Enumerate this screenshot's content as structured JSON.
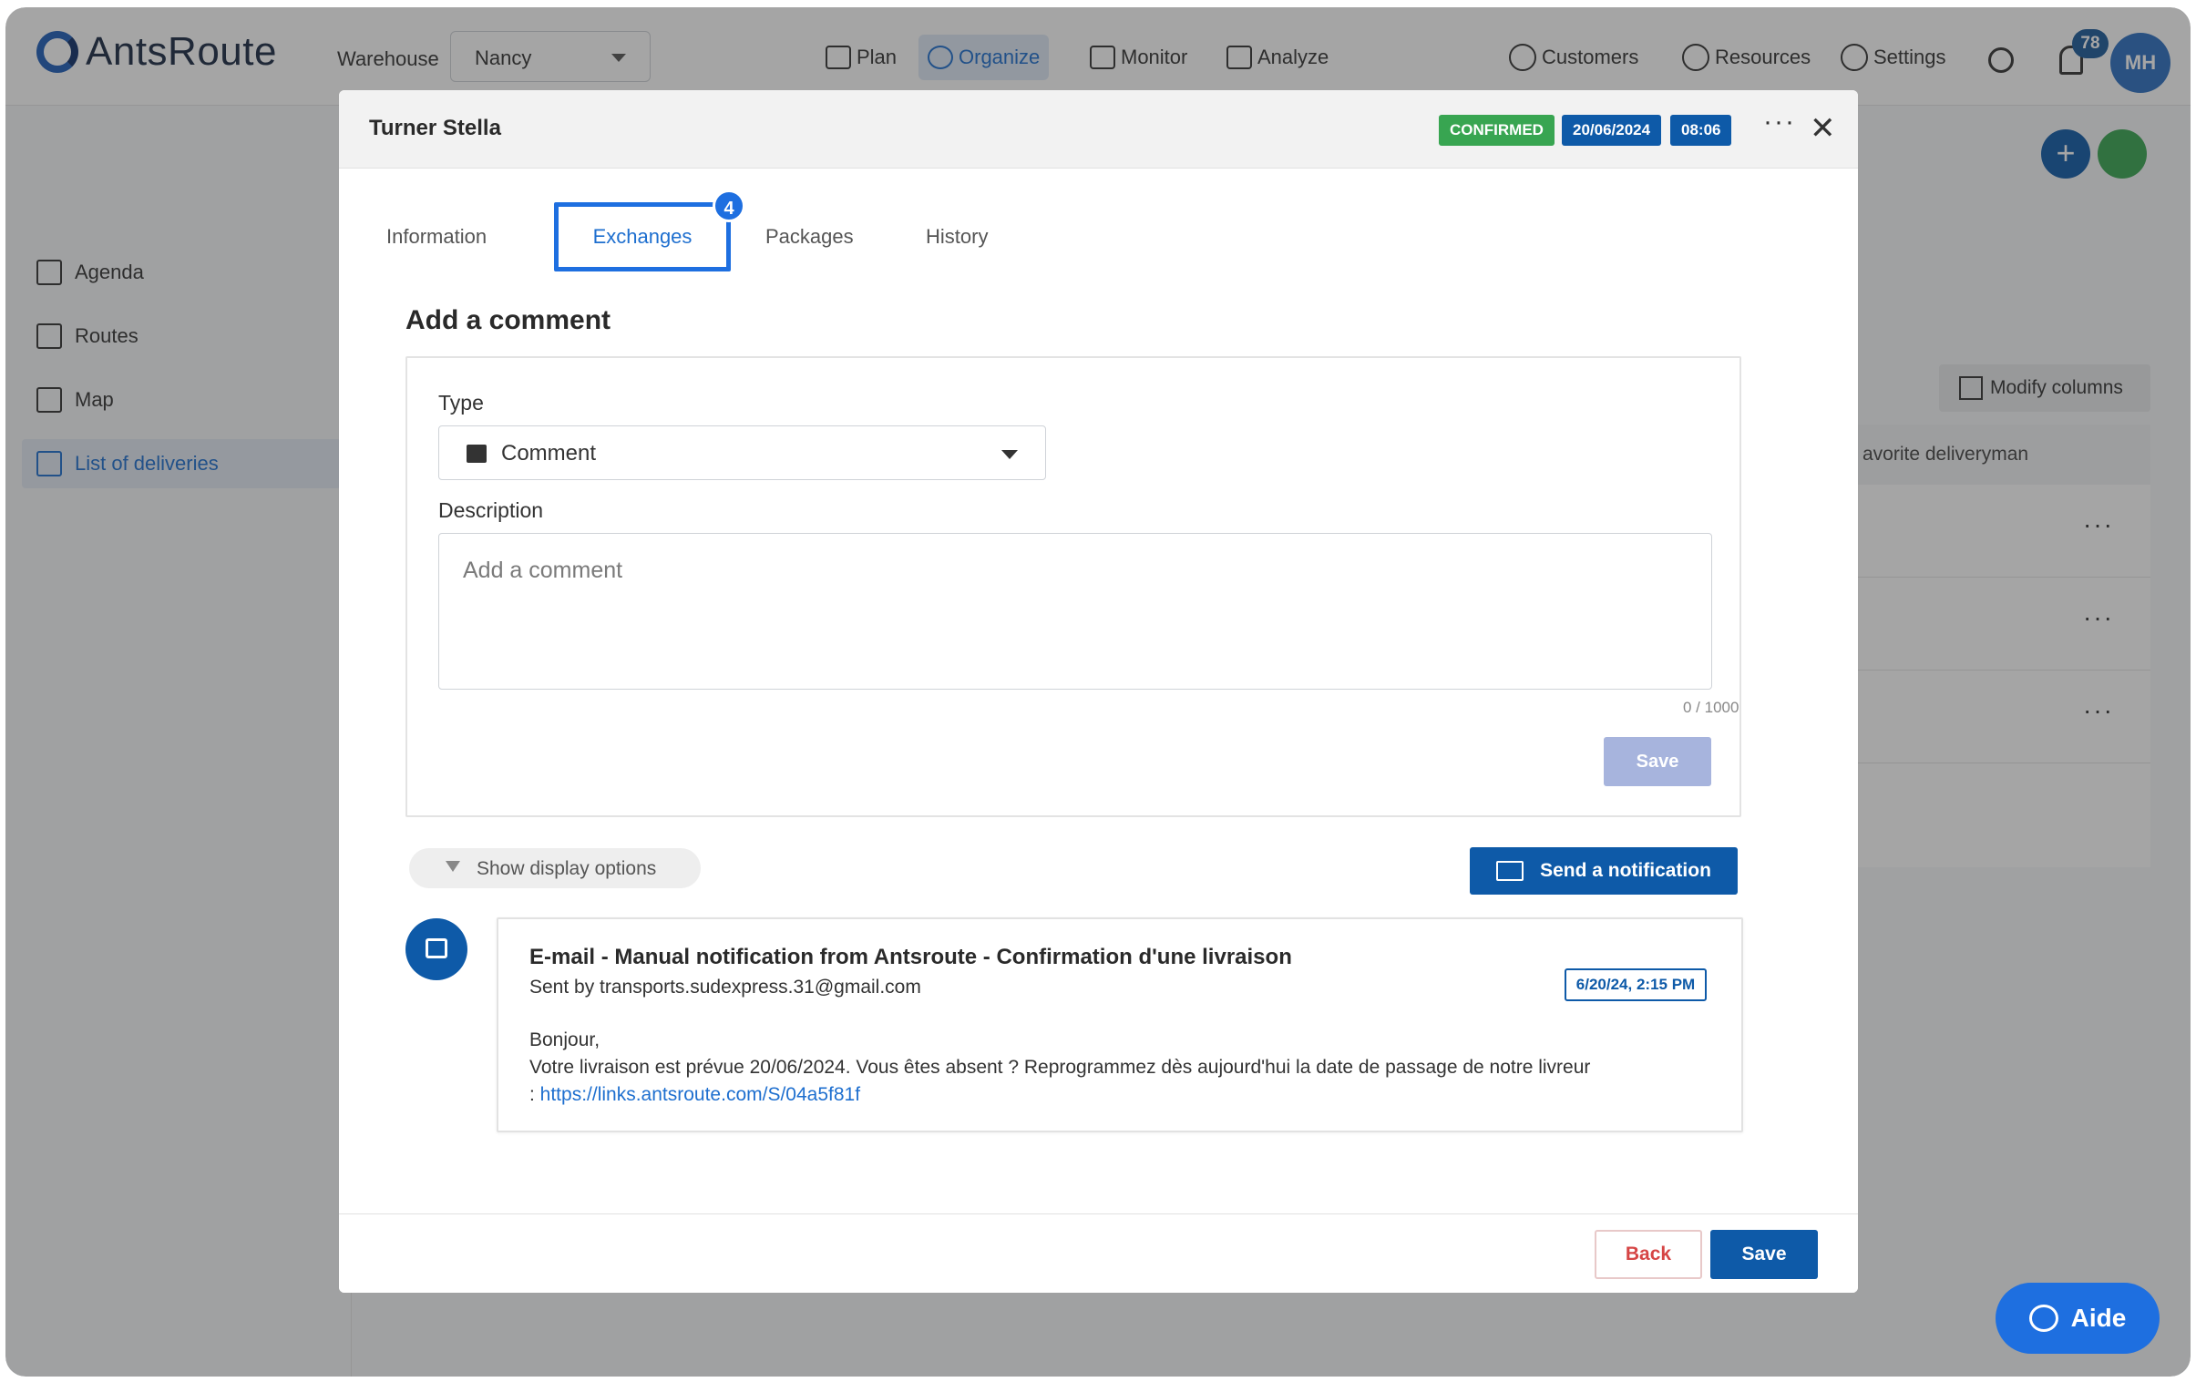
{
  "app": {
    "brand": "AntsRoute",
    "warehouse_label": "Warehouse",
    "warehouse_value": "Nancy",
    "nav": [
      "Plan",
      "Organize",
      "Monitor",
      "Analyze"
    ],
    "active_nav": "Organize",
    "right_nav": [
      "Customers",
      "Resources",
      "Settings"
    ],
    "notification_count": "78",
    "user_initials": "MH",
    "colors": {
      "primary": "#0e5aa8",
      "accent": "#1e6fe0",
      "success": "#38a551"
    }
  },
  "sidebar": {
    "items": [
      {
        "label": "Agenda",
        "icon": "calendar-icon"
      },
      {
        "label": "Routes",
        "icon": "route-icon"
      },
      {
        "label": "Map",
        "icon": "map-icon"
      },
      {
        "label": "List of deliveries",
        "icon": "list-icon"
      }
    ]
  },
  "background": {
    "modify_columns": "Modify columns",
    "column_header": "avorite deliveryman",
    "row_menu": "···"
  },
  "modal": {
    "title": "Turner Stella",
    "status": "CONFIRMED",
    "date": "20/06/2024",
    "time": "08:06",
    "more": "···",
    "close": "✕",
    "tabs": [
      {
        "label": "Information"
      },
      {
        "label": "Exchanges",
        "badge": "4"
      },
      {
        "label": "Packages"
      },
      {
        "label": "History"
      }
    ],
    "active_tab": "Exchanges",
    "section_title": "Add a comment",
    "form": {
      "type_label": "Type",
      "type_value": "Comment",
      "description_label": "Description",
      "description_placeholder": "Add a comment",
      "char_count": "0 / 1000",
      "save_label": "Save"
    },
    "display_options_label": "Show display options",
    "send_notification_label": "Send a notification",
    "exchange": {
      "title": "E-mail - Manual notification from Antsroute - Confirmation d'une livraison",
      "sender": "Sent by transports.sudexpress.31@gmail.com",
      "timestamp": "6/20/24, 2:15 PM",
      "greeting": "Bonjour,",
      "message": "Votre livraison est prévue 20/06/2024. Vous êtes absent ? Reprogrammez dès aujourd'hui la date de passage de notre livreur",
      "link_prefix": ": ",
      "link": "https://links.antsroute.com/S/04a5f81f"
    },
    "footer": {
      "back_label": "Back",
      "save_label": "Save"
    }
  },
  "help_button": "Aide"
}
